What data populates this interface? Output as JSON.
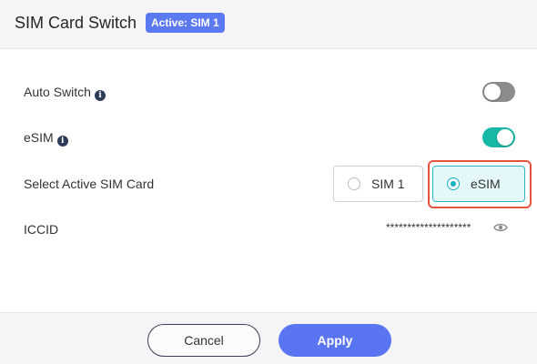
{
  "header": {
    "title": "SIM Card Switch",
    "badge": "Active: SIM 1"
  },
  "settings": {
    "auto_switch": {
      "label": "Auto Switch",
      "enabled": false
    },
    "esim": {
      "label": "eSIM",
      "enabled": true
    },
    "select_active": {
      "label": "Select Active SIM Card",
      "options": [
        "SIM 1",
        "eSIM"
      ],
      "selected": "eSIM"
    },
    "iccid": {
      "label": "ICCID",
      "value": "********************"
    }
  },
  "footer": {
    "cancel_label": "Cancel",
    "apply_label": "Apply"
  },
  "colors": {
    "accent": "#5a75f2",
    "toggle_on": "#16b7a4",
    "toggle_off": "#8c8c8c",
    "selected_radio": "#14b0c2",
    "highlight": "#e5533d"
  },
  "icons": [
    "info-icon",
    "eye-icon"
  ]
}
